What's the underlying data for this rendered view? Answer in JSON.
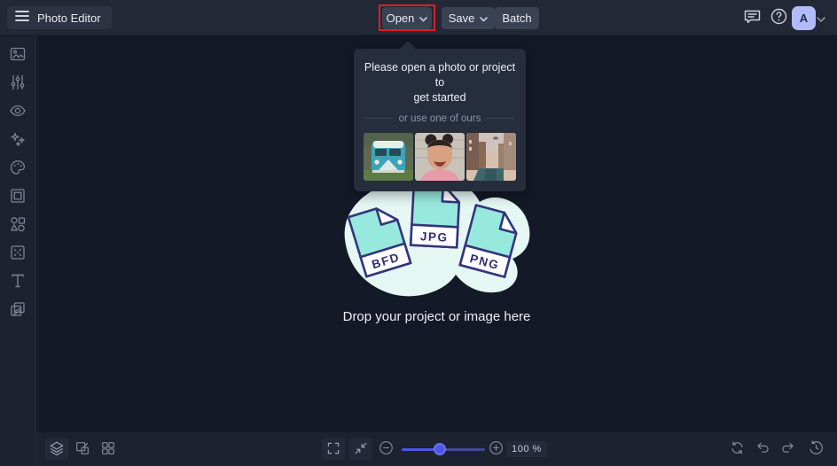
{
  "topbar": {
    "app_title": "Photo Editor",
    "open_label": "Open",
    "save_label": "Save",
    "batch_label": "Batch",
    "avatar_letter": "A"
  },
  "popup": {
    "title_line1": "Please open a photo or project to",
    "title_line2": "get started",
    "divider_text": "or use one of ours",
    "samples": [
      "teal-van-photo",
      "laughing-woman-photo",
      "canal-city-photo"
    ]
  },
  "canvas": {
    "drop_text": "Drop your project or image here",
    "file_types": [
      "BFD",
      "JPG",
      "PNG"
    ]
  },
  "bottombar": {
    "zoom_percent": "100 %"
  },
  "sidebar": {
    "icons": [
      "image",
      "adjust-sliders",
      "eye",
      "sparkles",
      "palette",
      "frame",
      "shapes",
      "overlay",
      "text",
      "texture"
    ]
  },
  "colors": {
    "accent_blue": "#4c58e4",
    "highlight_red": "#e01d22",
    "avatar_lavender": "#b2bcf8",
    "doc_fill": "#97e9dd",
    "doc_ink": "#34347c",
    "blob_mint": "#e4f7f2"
  }
}
